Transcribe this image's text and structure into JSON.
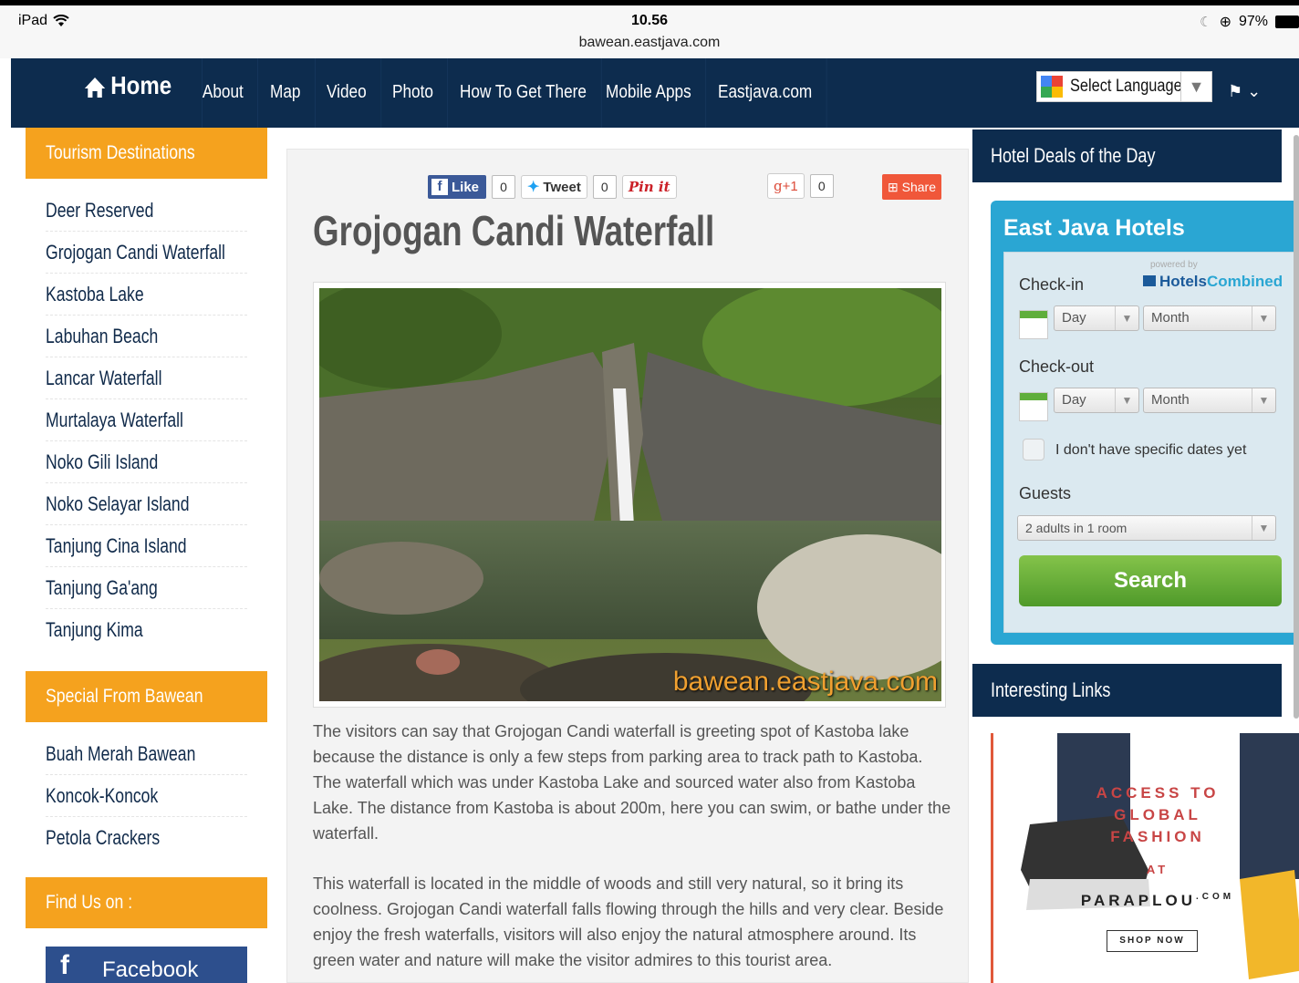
{
  "status_bar": {
    "device": "iPad",
    "time": "10.56",
    "url": "bawean.eastjava.com",
    "battery": "97%"
  },
  "nav": {
    "home": "Home",
    "items": [
      "About",
      "Map",
      "Video",
      "Photo",
      "How To Get There",
      "Mobile Apps",
      "Eastjava.com"
    ],
    "language_label": "Select Language"
  },
  "left_sidebar": {
    "destinations_header": "Tourism Destinations",
    "destinations": [
      "Deer Reserved",
      "Grojogan Candi Waterfall",
      "Kastoba Lake",
      "Labuhan Beach",
      "Lancar Waterfall",
      "Murtalaya Waterfall",
      "Noko Gili Island",
      "Noko Selayar Island",
      "Tanjung Cina Island",
      "Tanjung Ga'ang",
      "Tanjung Kima"
    ],
    "special_header": "Special From Bawean",
    "special": [
      "Buah Merah Bawean",
      "Koncok-Koncok",
      "Petola Crackers"
    ],
    "find_header": "Find Us on :",
    "facebook": "Facebook"
  },
  "social": {
    "like": "Like",
    "like_count": "0",
    "tweet": "Tweet",
    "tweet_count": "0",
    "pin": "Pin it",
    "gplus": "+1",
    "gplus_count": "0",
    "share": "Share"
  },
  "article": {
    "title": "Grojogan Candi Waterfall",
    "watermark": "bawean.eastjava.com",
    "paragraph1": "The visitors can say that Grojogan Candi waterfall is greeting spot of Kastoba lake because the distance is only a few steps from parking area to track path to Kastoba. The waterfall which was under Kastoba Lake and sourced water also from Kastoba Lake. The distance from Kastoba is about 200m, here you can swim, or bathe under the waterfall.",
    "paragraph2": "This waterfall is located in the middle of woods and still very natural, so it bring its coolness. Grojogan Candi waterfall falls flowing through the hills and very clear. Beside enjoy the fresh waterfalls, visitors will also enjoy the natural atmosphere around. Its green water and nature will make the visitor admires to this tourist area."
  },
  "right_sidebar": {
    "hotel_header": "Hotel Deals of the Day",
    "widget_title": "East Java Hotels",
    "powered_by": "powered by",
    "brand_a": "Hotels",
    "brand_b": "Combined",
    "checkin_label": "Check-in",
    "checkout_label": "Check-out",
    "day_placeholder": "Day",
    "month_placeholder": "Month",
    "no_dates": "I don't have specific dates yet",
    "guests_label": "Guests",
    "guests_value": "2 adults in 1 room",
    "search_label": "Search",
    "links_header": "Interesting Links",
    "ad_line1": "ACCESS TO",
    "ad_line2": "GLOBAL",
    "ad_line3": "FASHION",
    "ad_line4": "AT",
    "ad_brand": "PARAPLOU",
    "ad_brand_suffix": ".COM",
    "ad_cta": "SHOP NOW"
  }
}
